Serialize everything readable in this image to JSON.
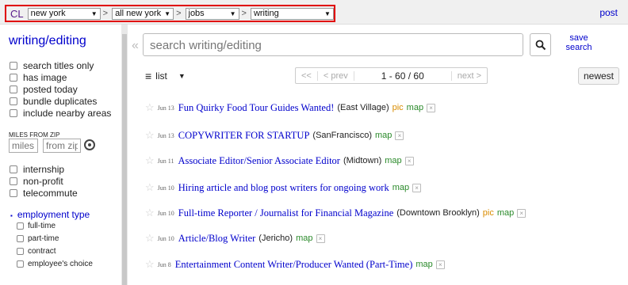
{
  "topbar": {
    "cl": "CL",
    "area": "new york",
    "subarea": "all new york",
    "section": "jobs",
    "category": "writing",
    "sep": ">",
    "post": "post"
  },
  "sidebar": {
    "title": "writing/editing",
    "filters": [
      "search titles only",
      "has image",
      "posted today",
      "bundle duplicates",
      "include nearby areas"
    ],
    "miles_label": "MILES FROM ZIP",
    "miles_placeholder": "miles",
    "zip_placeholder": "from zip",
    "job_filters": [
      "internship",
      "non-profit",
      "telecommute"
    ],
    "employment_type": "employment type",
    "employment_options": [
      "full-time",
      "part-time",
      "contract",
      "employee's choice"
    ]
  },
  "search": {
    "placeholder": "search writing/editing",
    "save_line1": "save",
    "save_line2": "search"
  },
  "controls": {
    "view": "list",
    "first": "<<",
    "prev": "< prev",
    "range": "1 - 60 / 60",
    "next": "next >",
    "sort": "newest"
  },
  "results": [
    {
      "date": "Jun 13",
      "title": "Fun Quirky Food Tour Guides Wanted!",
      "hood": "(East Village)",
      "pic": "pic",
      "map": "map"
    },
    {
      "date": "Jun 13",
      "title": "COPYWRITER FOR STARTUP",
      "hood": "(SanFrancisco)",
      "pic": "",
      "map": "map"
    },
    {
      "date": "Jun 11",
      "title": "Associate Editor/Senior Associate Editor",
      "hood": "(Midtown)",
      "pic": "",
      "map": "map"
    },
    {
      "date": "Jun 10",
      "title": "Hiring article and blog post writers for ongoing work",
      "hood": "",
      "pic": "",
      "map": "map"
    },
    {
      "date": "Jun 10",
      "title": "Full-time Reporter / Journalist for Financial Magazine",
      "hood": "(Downtown Brooklyn)",
      "pic": "pic",
      "map": "map"
    },
    {
      "date": "Jun 10",
      "title": "Article/Blog Writer",
      "hood": "(Jericho)",
      "pic": "",
      "map": "map"
    },
    {
      "date": "Jun 8",
      "title": "Entertainment Content Writer/Producer Wanted (Part-Time)",
      "hood": "",
      "pic": "",
      "map": "map"
    }
  ]
}
